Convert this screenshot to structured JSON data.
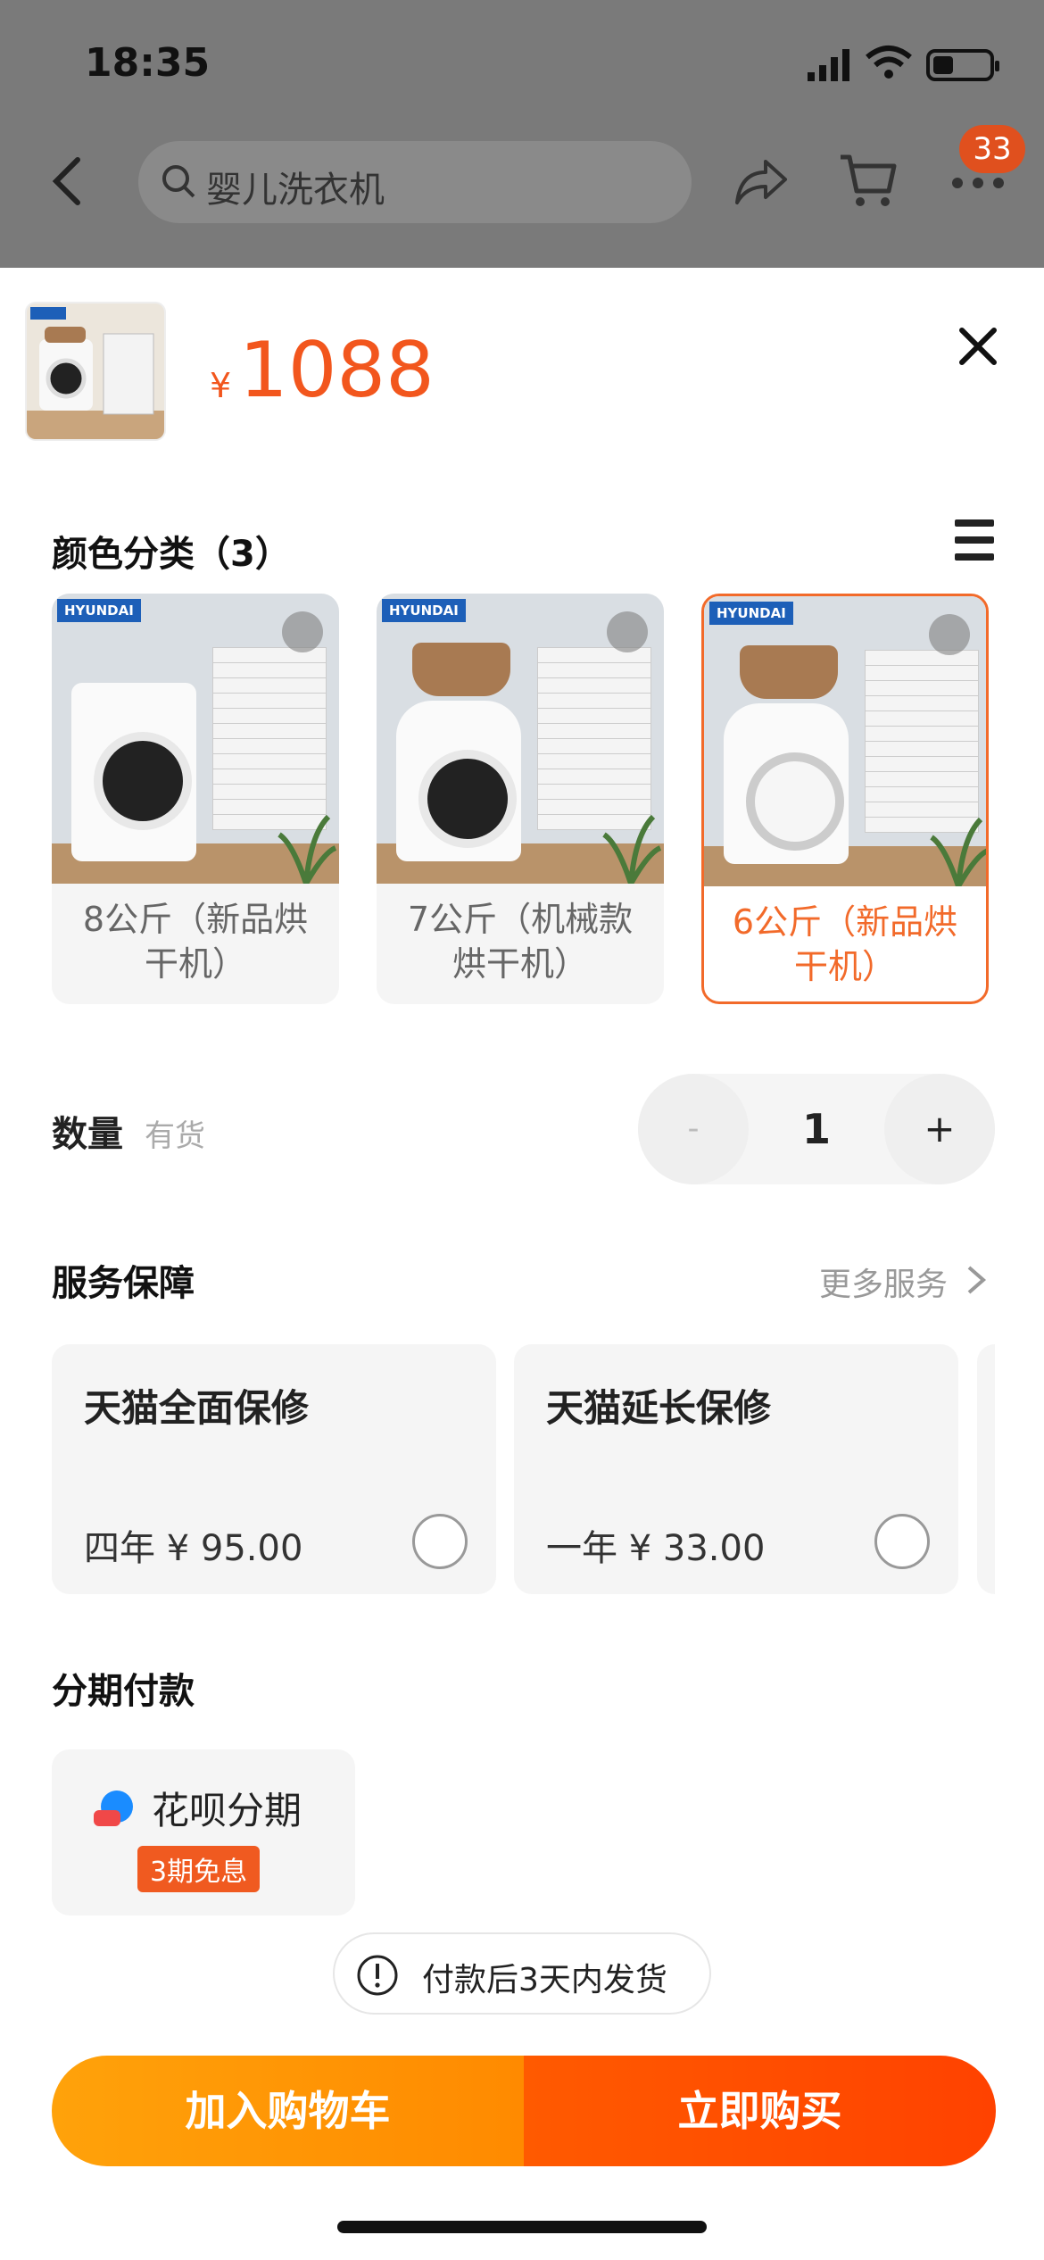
{
  "status": {
    "time": "18:35"
  },
  "nav": {
    "search_text": "婴儿洗衣机",
    "badge_count": "33"
  },
  "product": {
    "currency": "¥",
    "price": "1088"
  },
  "color_section": {
    "title": "颜色分类（3）",
    "options": [
      {
        "label": "8公斤（新品烘干机）",
        "brand": "HYUNDAI",
        "selected": false
      },
      {
        "label": "7公斤（机械款烘干机）",
        "brand": "HYUNDAI",
        "selected": false
      },
      {
        "label": "6公斤（新品烘干机）",
        "brand": "HYUNDAI",
        "selected": true
      }
    ]
  },
  "quantity": {
    "label": "数量",
    "stock": "有货",
    "minus": "-",
    "value": "1",
    "plus": "+"
  },
  "services": {
    "title": "服务保障",
    "more": "更多服务",
    "items": [
      {
        "name": "天猫全面保修",
        "price": "四年 ¥ 95.00"
      },
      {
        "name": "天猫延长保修",
        "price": "一年 ¥ 33.00"
      }
    ]
  },
  "installment": {
    "title": "分期付款",
    "option_name": "花呗分期",
    "tag": "3期免息"
  },
  "shipping": {
    "text": "付款后3天内发货"
  },
  "actions": {
    "add_to_cart": "加入购物车",
    "buy_now": "立即购买"
  },
  "colors": {
    "accent": "#f2561d",
    "cart_button": "#ff9800",
    "buy_button": "#ff4d00"
  }
}
